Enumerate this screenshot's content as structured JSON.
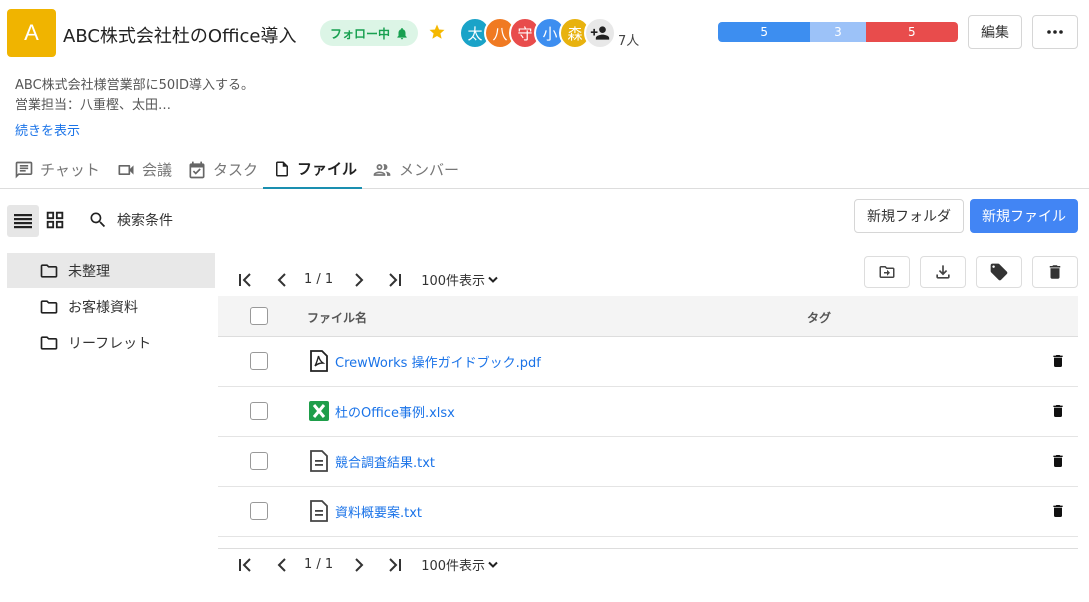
{
  "project": {
    "initial": "A",
    "title": "ABC株式会社杜のOffice導入",
    "follow_label": "フォロー中",
    "member_count": "7人",
    "members": [
      {
        "initial": "太",
        "color": "#1aa3c8"
      },
      {
        "initial": "八",
        "color": "#f07a22"
      },
      {
        "initial": "守",
        "color": "#e84c4c"
      },
      {
        "initial": "小",
        "color": "#3d8ef0"
      },
      {
        "initial": "森",
        "color": "#e8b20e"
      }
    ],
    "progress": [
      {
        "label": "5",
        "value": 5,
        "color": "#3d8ef0"
      },
      {
        "label": "3",
        "value": 3,
        "color": "#9cc2f8"
      },
      {
        "label": "5",
        "value": 5,
        "color": "#e84c4c"
      }
    ],
    "edit_label": "編集",
    "desc_line1": "ABC株式会社様営業部に50ID導入する。",
    "desc_line2": "営業担当：八重樫、太田…",
    "more_link": "続きを表示"
  },
  "tabs": [
    {
      "label": "チャット"
    },
    {
      "label": "会議"
    },
    {
      "label": "タスク"
    },
    {
      "label": "ファイル"
    },
    {
      "label": "メンバー"
    }
  ],
  "toolbar": {
    "search_label": "検索条件",
    "new_folder": "新規フォルダ",
    "new_file": "新規ファイル"
  },
  "folders": [
    {
      "name": "未整理"
    },
    {
      "name": "お客様資料"
    },
    {
      "name": "リーフレット"
    }
  ],
  "pager": {
    "page_text": "1 / 1",
    "page_size": "100件表示"
  },
  "table": {
    "col_name": "ファイル名",
    "col_tag": "タグ",
    "rows": [
      {
        "name": "CrewWorks 操作ガイドブック.pdf",
        "type": "pdf"
      },
      {
        "name": "杜のOffice事例.xlsx",
        "type": "xlsx"
      },
      {
        "name": "競合調査結果.txt",
        "type": "txt"
      },
      {
        "name": "資料概要案.txt",
        "type": "txt"
      }
    ]
  },
  "colors": {
    "accent": "#4285f4",
    "tab_underline": "#1a8fb0",
    "follow_green": "#18a050"
  }
}
